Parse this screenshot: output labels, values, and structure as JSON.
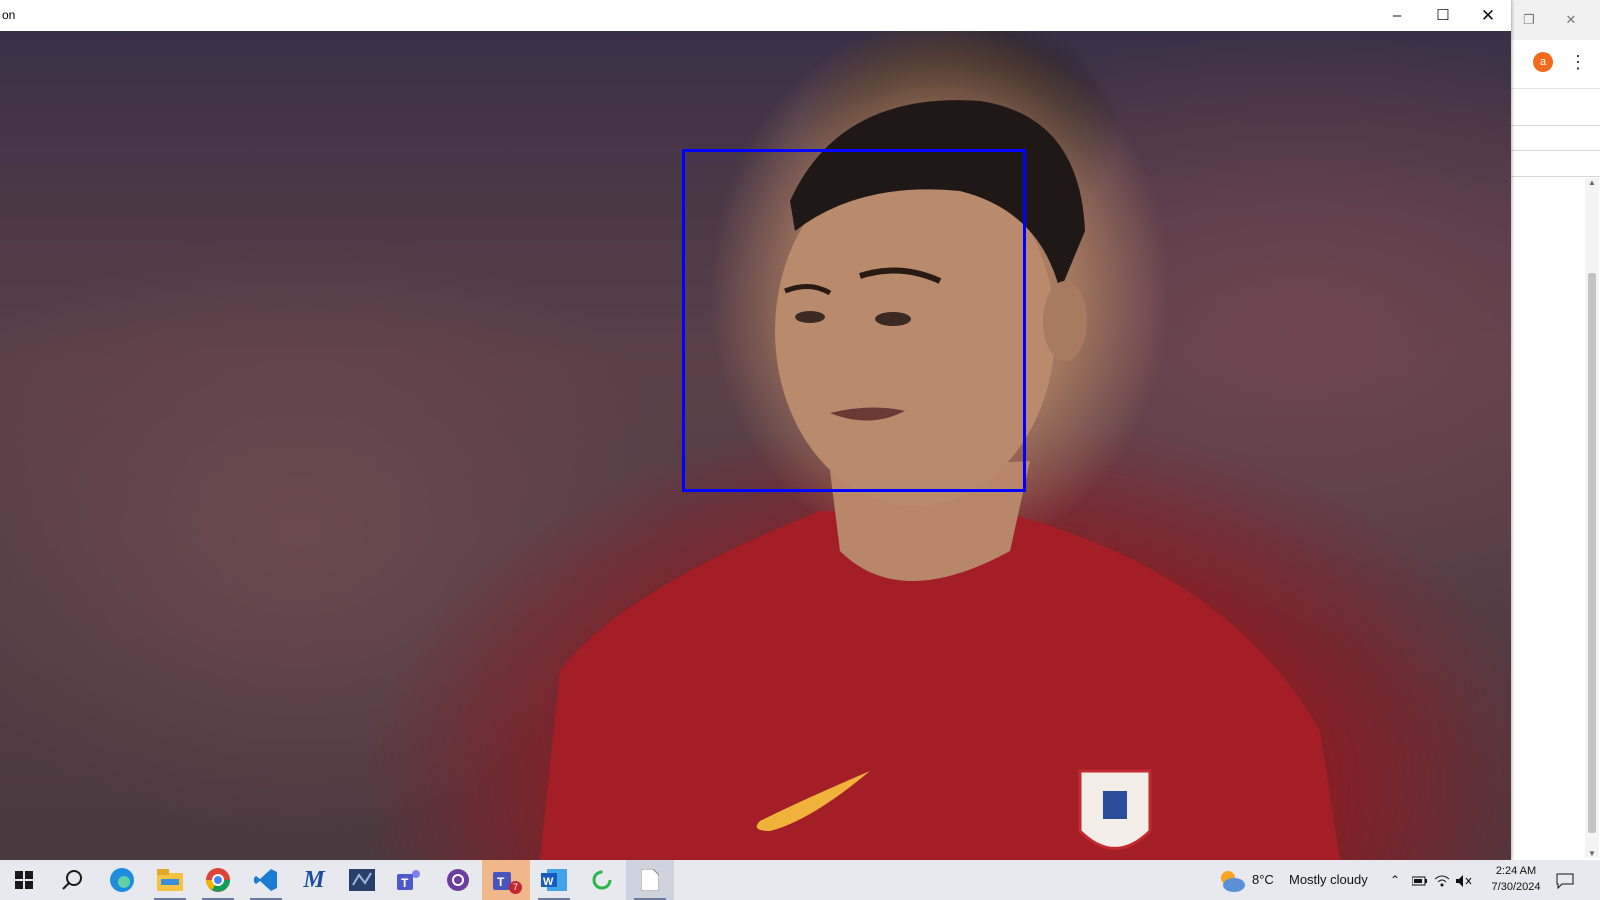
{
  "window": {
    "title": "on"
  },
  "background_browser": {
    "avatar_letter": "a",
    "accent": "#f26a1b"
  },
  "face_box_color": "#0000ff",
  "taskbar": {
    "apps": [
      "start-icon",
      "search-icon",
      "edge-icon",
      "file-explorer-icon",
      "chrome-icon",
      "vscode-icon",
      "m-app-icon",
      "visual-studio-icon",
      "teams-icon",
      "github-desktop-icon",
      "teams-badge-icon",
      "word-icon",
      "loading-app-icon",
      "notepad-icon"
    ],
    "teams_badge": "7",
    "weather_temp": "8°C",
    "weather_text": "Mostly cloudy",
    "time": "2:24 AM",
    "date": "7/30/2024"
  }
}
